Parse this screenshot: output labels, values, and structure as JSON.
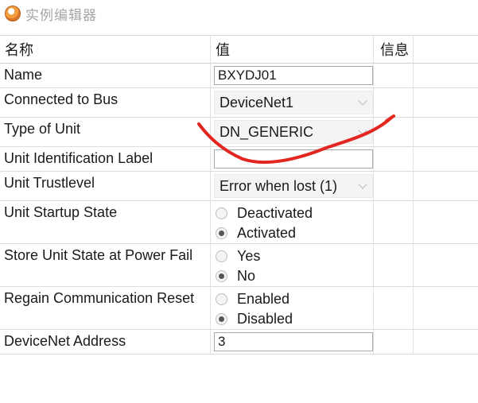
{
  "window": {
    "title": "实例编辑器",
    "icon": "app-logo-icon"
  },
  "table": {
    "headers": {
      "name": "名称",
      "value": "值",
      "info": "信息"
    },
    "rows": [
      {
        "name": "Name",
        "kind": "text",
        "value": "BXYDJ01"
      },
      {
        "name": "Connected to Bus",
        "kind": "select",
        "value": "DeviceNet1"
      },
      {
        "name": "Type of Unit",
        "kind": "select",
        "value": "DN_GENERIC"
      },
      {
        "name": "Unit Identification Label",
        "kind": "text",
        "value": ""
      },
      {
        "name": "Unit Trustlevel",
        "kind": "select",
        "value": "Error when lost (1)"
      },
      {
        "name": "Unit Startup State",
        "kind": "radio",
        "options": [
          "Deactivated",
          "Activated"
        ],
        "selected": "Activated"
      },
      {
        "name": "Store Unit State at Power Fail",
        "kind": "radio",
        "options": [
          "Yes",
          "No"
        ],
        "selected": "No"
      },
      {
        "name": "Regain Communication Reset",
        "kind": "radio",
        "options": [
          "Enabled",
          "Disabled"
        ],
        "selected": "Disabled"
      },
      {
        "name": "DeviceNet Address",
        "kind": "text",
        "value": "3"
      }
    ]
  },
  "annotation": {
    "color": "#e3261f"
  }
}
